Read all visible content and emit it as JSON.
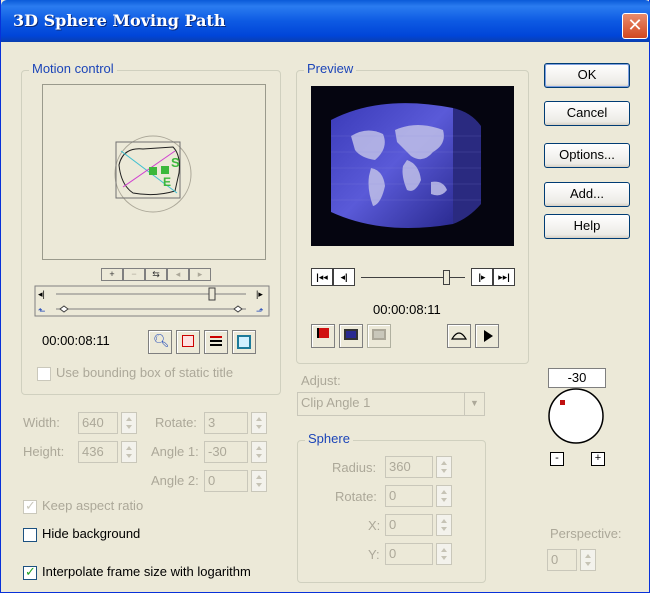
{
  "window": {
    "title": "3D Sphere Moving Path",
    "close_glyph": "✕"
  },
  "buttons": {
    "ok": "OK",
    "cancel": "Cancel",
    "options": "Options...",
    "add": "Add...",
    "help": "Help"
  },
  "motion_control": {
    "label": "Motion control",
    "timecode": "00:00:08:11",
    "bounding_box_label": "Use bounding box of static title",
    "bounding_box_checked": false,
    "sphere_letters": [
      "S",
      "E"
    ]
  },
  "preview": {
    "label": "Preview",
    "timecode": "00:00:08:11"
  },
  "adjust": {
    "label": "Adjust:",
    "selected": "Clip Angle 1"
  },
  "angle_dial": {
    "value": "-30",
    "minus": "-",
    "plus": "+"
  },
  "fields": {
    "width": {
      "label": "Width:",
      "value": "640"
    },
    "height": {
      "label": "Height:",
      "value": "436"
    },
    "rotate": {
      "label": "Rotate:",
      "value": "3"
    },
    "angle1": {
      "label": "Angle 1:",
      "value": "-30"
    },
    "angle2": {
      "label": "Angle 2:",
      "value": "0"
    }
  },
  "sphere": {
    "label": "Sphere",
    "radius": {
      "label": "Radius:",
      "value": "360"
    },
    "rotate": {
      "label": "Rotate:",
      "value": "0"
    },
    "x": {
      "label": "X:",
      "value": "0"
    },
    "y": {
      "label": "Y:",
      "value": "0"
    }
  },
  "perspective": {
    "label": "Perspective:",
    "value": "0"
  },
  "checkboxes": {
    "keep_aspect": {
      "label": "Keep aspect ratio",
      "checked": true
    },
    "hide_background": {
      "label": "Hide background",
      "checked": false
    },
    "interpolate": {
      "label": "Interpolate frame size with logarithm",
      "checked": true
    }
  },
  "colors": {
    "titlebar": "#0a5ad8",
    "group_label": "#1c45b8",
    "path_green": "#3cb83c",
    "path_magenta": "#d040d0"
  }
}
